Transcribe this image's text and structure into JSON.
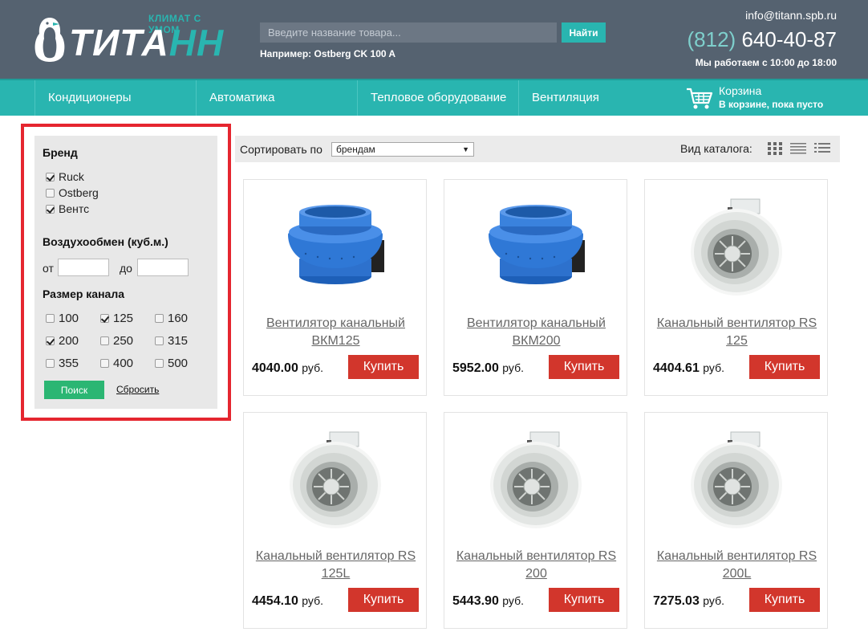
{
  "header": {
    "logo_tagline": "КЛИМАТ С УМОМ",
    "logo_main": "ТИТА",
    "logo_accent": "НН",
    "search_placeholder": "Введите название товара...",
    "search_button": "Найти",
    "search_hint": "Например: Ostberg CK 100 A",
    "email": "info@titann.spb.ru",
    "phone_code": "(812)",
    "phone_number": "640-40-87",
    "hours": "Мы работаем с 10:00 до 18:00"
  },
  "nav": {
    "items": [
      "Кондиционеры",
      "Автоматика",
      "Тепловое оборудование",
      "Вентиляция"
    ],
    "cart_title": "Корзина",
    "cart_status": "В корзине, пока пусто"
  },
  "filter": {
    "brand_title": "Бренд",
    "brands": [
      {
        "label": "Ruck",
        "checked": true
      },
      {
        "label": "Ostberg",
        "checked": false
      },
      {
        "label": "Вентс",
        "checked": true
      }
    ],
    "airflow_title": "Воздухообмен (куб.м.)",
    "from_label": "от",
    "to_label": "до",
    "size_title": "Размер канала",
    "sizes": [
      {
        "label": "100",
        "checked": false
      },
      {
        "label": "125",
        "checked": true
      },
      {
        "label": "160",
        "checked": false
      },
      {
        "label": "200",
        "checked": true
      },
      {
        "label": "250",
        "checked": false
      },
      {
        "label": "315",
        "checked": false
      },
      {
        "label": "355",
        "checked": false
      },
      {
        "label": "400",
        "checked": false
      },
      {
        "label": "500",
        "checked": false
      }
    ],
    "search_button": "Поиск",
    "reset_link": "Сбросить"
  },
  "sortbar": {
    "sort_label": "Сортировать по",
    "sort_value": "брендам",
    "view_label": "Вид каталога:"
  },
  "products": [
    {
      "name": "Вентилятор канальный ВКМ125",
      "price": "4040.00",
      "currency": "руб.",
      "buy": "Купить",
      "image": "blue-duct-fan"
    },
    {
      "name": "Вентилятор канальный ВКМ200",
      "price": "5952.00",
      "currency": "руб.",
      "buy": "Купить",
      "image": "blue-duct-fan"
    },
    {
      "name": "Канальный вентилятор RS 125",
      "price": "4404.61",
      "currency": "руб.",
      "buy": "Купить",
      "image": "white-duct-fan"
    },
    {
      "name": "Канальный вентилятор RS 125L",
      "price": "4454.10",
      "currency": "руб.",
      "buy": "Купить",
      "image": "white-duct-fan"
    },
    {
      "name": "Канальный вентилятор RS 200",
      "price": "5443.90",
      "currency": "руб.",
      "buy": "Купить",
      "image": "white-duct-fan"
    },
    {
      "name": "Канальный вентилятор RS 200L",
      "price": "7275.03",
      "currency": "руб.",
      "buy": "Купить",
      "image": "white-duct-fan"
    }
  ],
  "colors": {
    "header_bg": "#556270",
    "accent": "#29b5b0",
    "buy_button": "#d2362c",
    "search_green": "#2bb673",
    "highlight_outline": "#e5262f"
  }
}
